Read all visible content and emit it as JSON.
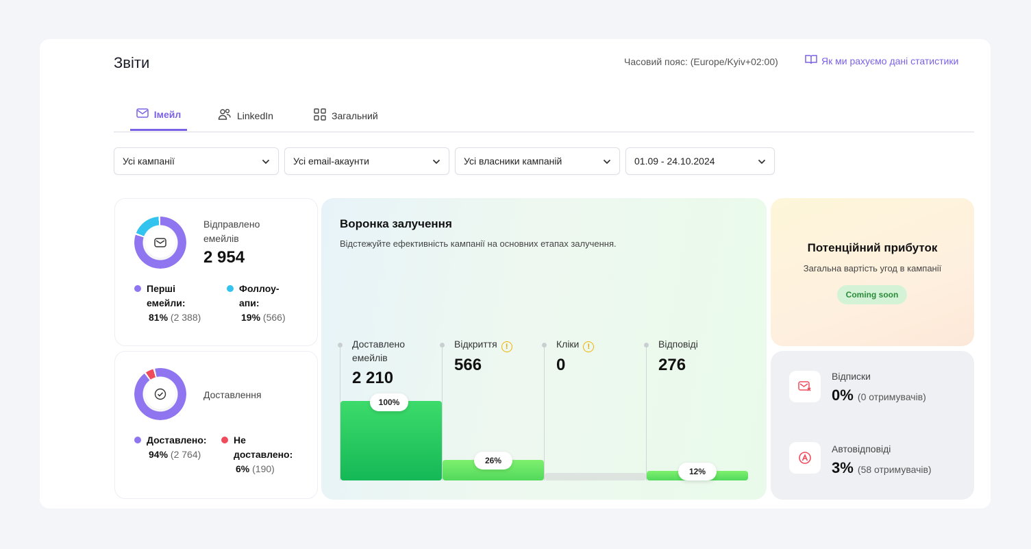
{
  "header": {
    "title": "Звіти",
    "timezone": "Часовий пояс: (Europe/Kyiv+02:00)",
    "how_link": "Як ми рахуємо дані статистики"
  },
  "tabs": [
    {
      "label": "Імейл",
      "icon": "mail-icon",
      "active": true
    },
    {
      "label": "LinkedIn",
      "icon": "users-icon",
      "active": false
    },
    {
      "label": "Загальний",
      "icon": "grid-icon",
      "active": false
    }
  ],
  "filters": [
    {
      "value": "Усі кампанії"
    },
    {
      "value": "Усі email-акаунти"
    },
    {
      "value": "Усі власники кампаній"
    },
    {
      "value": "01.09 - 24.10.2024"
    }
  ],
  "sent": {
    "label": "Відправлено емейлів",
    "total": "2 954",
    "first_label": "Перші емейли:",
    "first_pct": "81%",
    "first_count": "(2 388)",
    "first_share": 0.81,
    "follow_label": "Фоллоу-апи:",
    "follow_pct": "19%",
    "follow_count": "(566)"
  },
  "delivery": {
    "label": "Доставлення",
    "delivered_label": "Доставлено:",
    "delivered_pct": "94%",
    "delivered_count": "(2 764)",
    "delivered_share": 0.94,
    "undelivered_label": "Не доставлено:",
    "undelivered_pct": "6%",
    "undelivered_count": "(190)"
  },
  "funnel": {
    "title": "Воронка залучення",
    "subtitle": "Відстежуйте ефективність кампанії на основних етапах залучення.",
    "stages": [
      {
        "label": "Доставлено емейлів",
        "value": "2 210",
        "pct": "100%",
        "fraction": 1.0,
        "warning": false
      },
      {
        "label": "Відкриття",
        "value": "566",
        "pct": "26%",
        "fraction": 0.26,
        "warning": true
      },
      {
        "label": "Кліки",
        "value": "0",
        "pct": "",
        "fraction": 0.0,
        "warning": true
      },
      {
        "label": "Відповіді",
        "value": "276",
        "pct": "12%",
        "fraction": 0.12,
        "warning": false
      }
    ]
  },
  "profit": {
    "title": "Потенційний прибуток",
    "subtitle": "Загальна вартість угод в кампанії",
    "badge": "Coming soon"
  },
  "stats": {
    "unsub_label": "Відписки",
    "unsub_value": "0%",
    "unsub_detail": "(0 отримувачів)",
    "auto_label": "Автовідповіді",
    "auto_value": "3%",
    "auto_detail": "(58 отримувачів)"
  },
  "colors": {
    "accent": "#7b61e6",
    "donut_primary": "#8f75ef",
    "donut_secondary": "#33c3ef",
    "undelivered": "#ef4b5c",
    "bar_green": "#22c55e",
    "bar_light_green": "#6ae66a"
  }
}
